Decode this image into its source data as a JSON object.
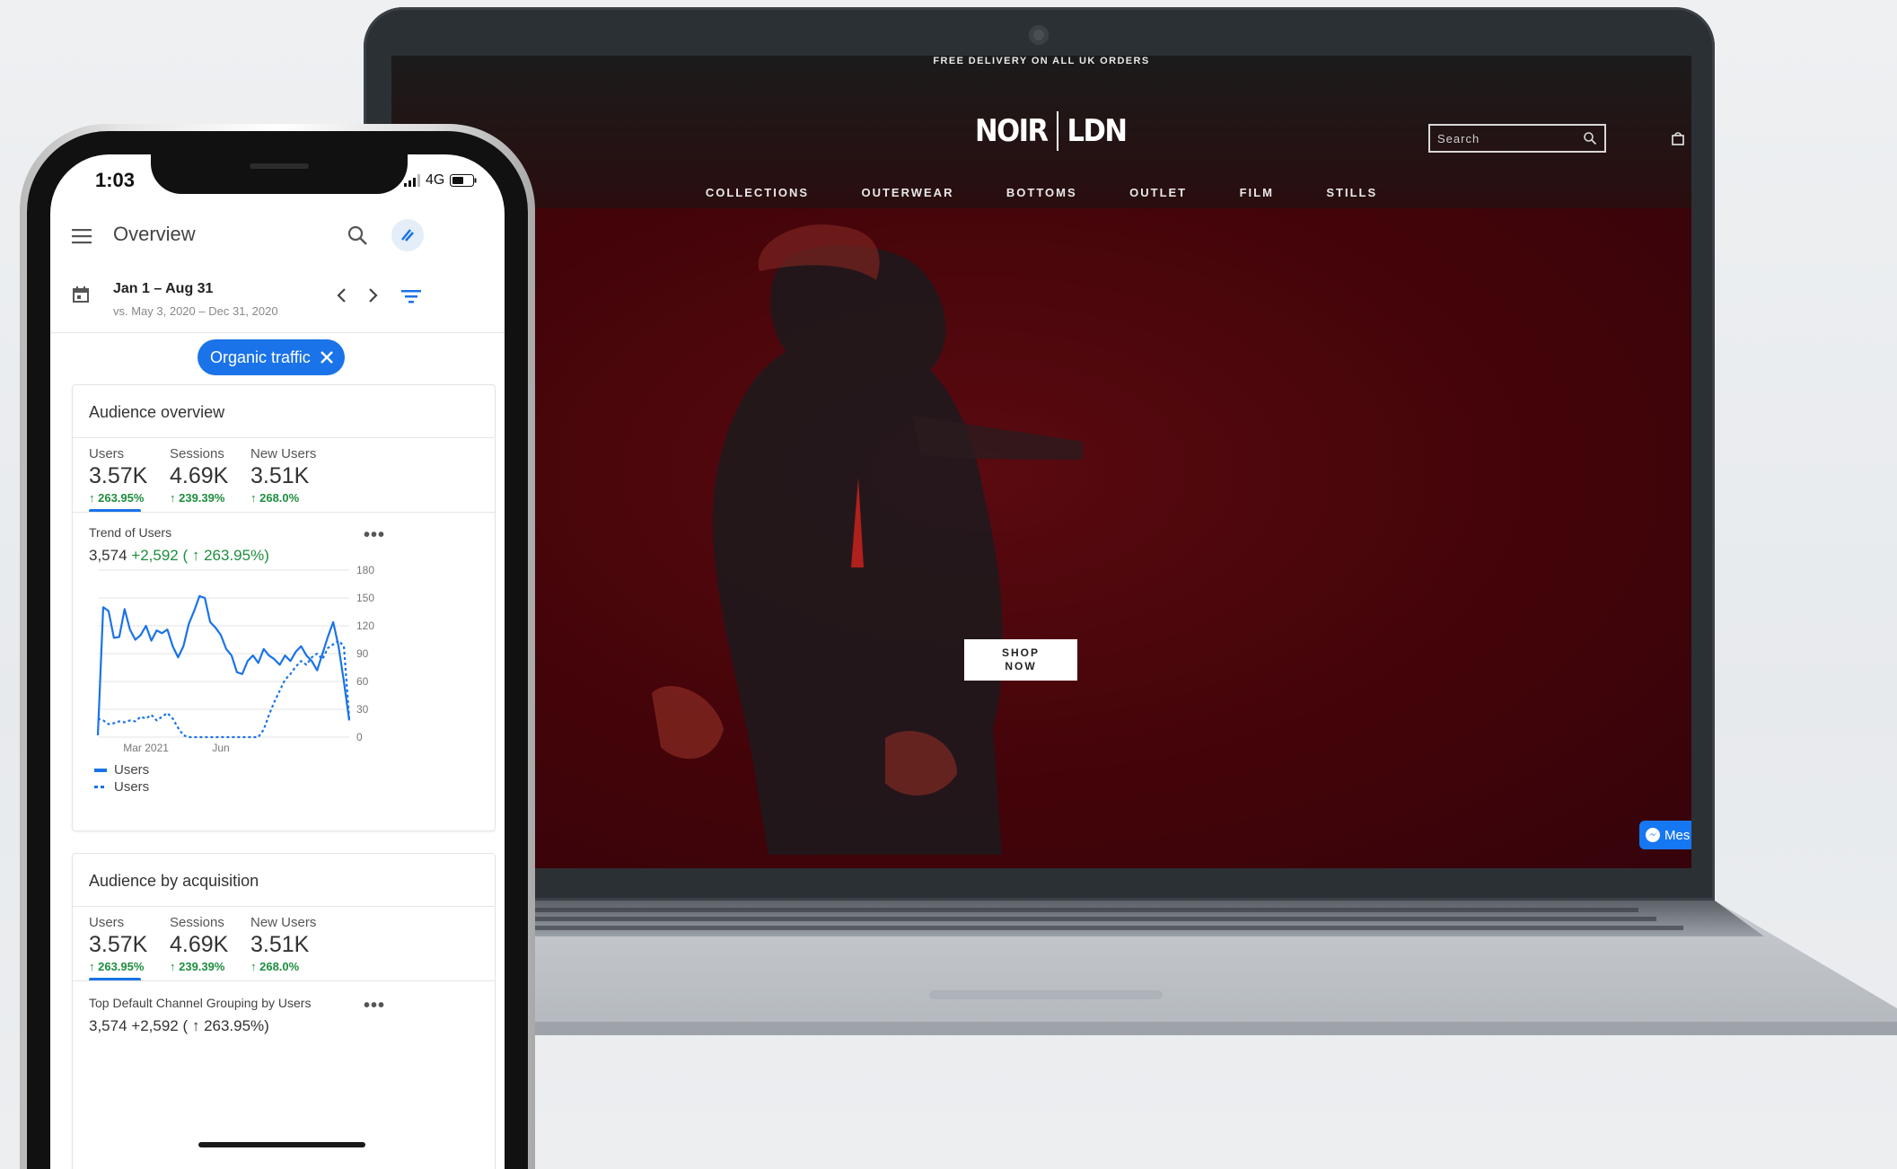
{
  "website": {
    "announcement": "FREE DELIVERY ON ALL UK ORDERS",
    "logo_left": "NOIR",
    "logo_right": "LDN",
    "search_placeholder": "Search",
    "nav": [
      "COLLECTIONS",
      "OUTERWEAR",
      "BOTTOMS",
      "OUTLET",
      "FILM",
      "STILLS"
    ],
    "cta_line1": "SHOP",
    "cta_line2": "NOW",
    "messenger_label": "Mes",
    "icons": [
      "search-icon",
      "cart-icon",
      "messenger-icon"
    ],
    "colors": {
      "hero": "#430409",
      "accent": "#1677f2"
    }
  },
  "phone": {
    "status": {
      "time": "1:03",
      "network": "4G"
    },
    "appbar": {
      "title": "Overview"
    },
    "date": {
      "range": "Jan 1 – Aug 31",
      "compare": "vs. May 3, 2020 – Dec 31, 2020"
    },
    "filter_chip": "Organic traffic",
    "audience_overview": {
      "title": "Audience overview",
      "metrics": [
        {
          "label": "Users",
          "value": "3.57K",
          "change": "↑ 263.95%"
        },
        {
          "label": "Sessions",
          "value": "4.69K",
          "change": "↑ 239.39%"
        },
        {
          "label": "New Users",
          "value": "3.51K",
          "change": "↑ 268.0%"
        }
      ],
      "trend_title": "Trend of Users",
      "trend_total": "3,574",
      "trend_change": "+2,592 ( ↑ 263.95%)"
    },
    "audience_acquisition": {
      "title": "Audience by acquisition",
      "metrics": [
        {
          "label": "Users",
          "value": "3.57K",
          "change": "↑ 263.95%"
        },
        {
          "label": "Sessions",
          "value": "4.69K",
          "change": "↑ 239.39%"
        },
        {
          "label": "New Users",
          "value": "3.51K",
          "change": "↑ 268.0%"
        }
      ],
      "footer_title": "Top Default Channel Grouping by Users",
      "footer_value": "3,574 +2,592 ( ↑ 263.95%)"
    },
    "colors": {
      "primary": "#1a73e8",
      "positive": "#1e8e3e"
    }
  },
  "chart_data": {
    "type": "line",
    "x": [
      0,
      1,
      2,
      3,
      4,
      5,
      6,
      7,
      8,
      9,
      10,
      11,
      12,
      13,
      14,
      15,
      16,
      17,
      18,
      19,
      20,
      21,
      22,
      23,
      24,
      25,
      26,
      27,
      28,
      29,
      30,
      31,
      32,
      33,
      34,
      35,
      36,
      37,
      38,
      39,
      40,
      41,
      42,
      43,
      44,
      45,
      46,
      47
    ],
    "series": [
      {
        "name": "Users",
        "style": "solid",
        "values": [
          2,
          140,
          136,
          107,
          108,
          138,
          116,
          105,
          110,
          120,
          104,
          115,
          112,
          116,
          98,
          86,
          98,
          122,
          136,
          152,
          150,
          124,
          118,
          110,
          95,
          88,
          70,
          68,
          82,
          88,
          80,
          95,
          88,
          84,
          78,
          88,
          82,
          92,
          98,
          88,
          82,
          72,
          90,
          108,
          124,
          98,
          60,
          18
        ]
      },
      {
        "name": "Users",
        "style": "dotted",
        "values": [
          20,
          18,
          14,
          15,
          17,
          16,
          18,
          17,
          22,
          20,
          24,
          18,
          22,
          26,
          20,
          10,
          2,
          0,
          0,
          0,
          0,
          0,
          0,
          0,
          0,
          0,
          0,
          0,
          0,
          0,
          0,
          8,
          24,
          38,
          50,
          62,
          68,
          76,
          82,
          78,
          86,
          90,
          84,
          96,
          100,
          104,
          98,
          20
        ]
      }
    ],
    "x_ticks": [
      {
        "at": 9,
        "label": "Mar 2021"
      },
      {
        "at": 23,
        "label": "Jun"
      }
    ],
    "y_ticks": [
      0,
      30,
      60,
      90,
      120,
      150,
      180
    ],
    "ylim": [
      0,
      180
    ],
    "grid": true,
    "legend": "bottom-left"
  }
}
